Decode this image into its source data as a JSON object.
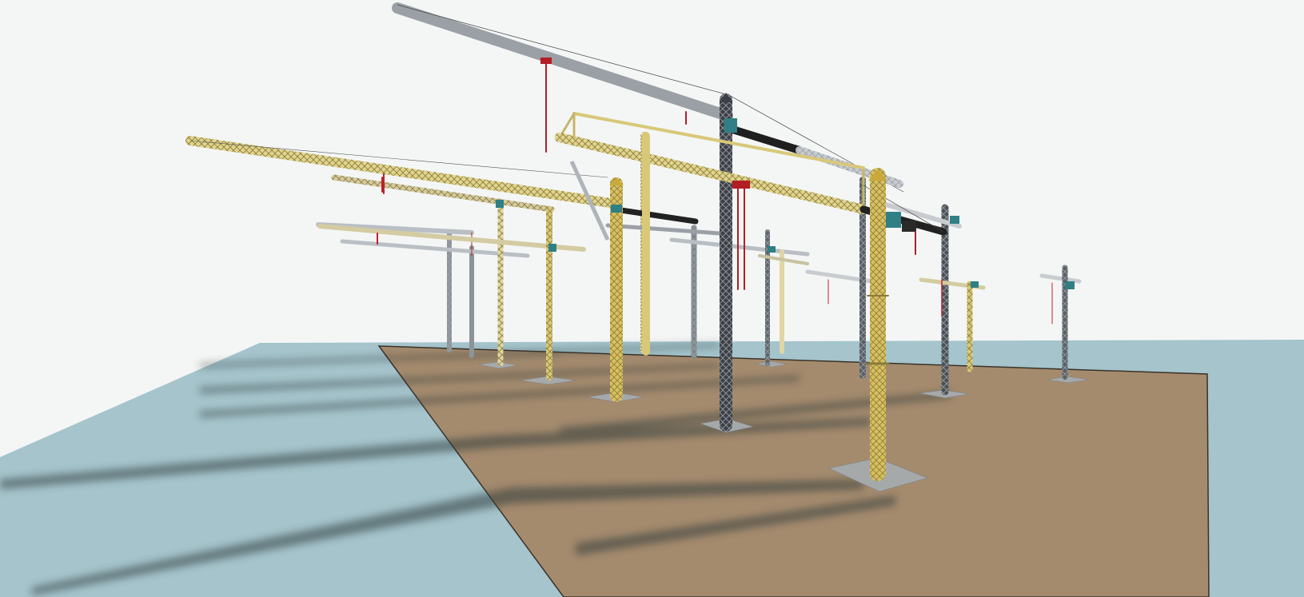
{
  "scene": {
    "kind": "3d-render",
    "colors": {
      "sky": "#f4f6f5",
      "water": "#a5c4cc",
      "ground": "#a58b6e",
      "ground_edge": "#3a3228",
      "shadow": "#2f3a3a",
      "crane_yellow": "#d8c878",
      "crane_yellow_dark": "#8a7a3a",
      "crane_dark": "#3c4046",
      "crane_light": "#c8ccd0",
      "cab": "#2f7f84",
      "hook": "#b21e24",
      "base_plate": "#a6a9aa",
      "counterweight": "#2a2a2a"
    }
  }
}
